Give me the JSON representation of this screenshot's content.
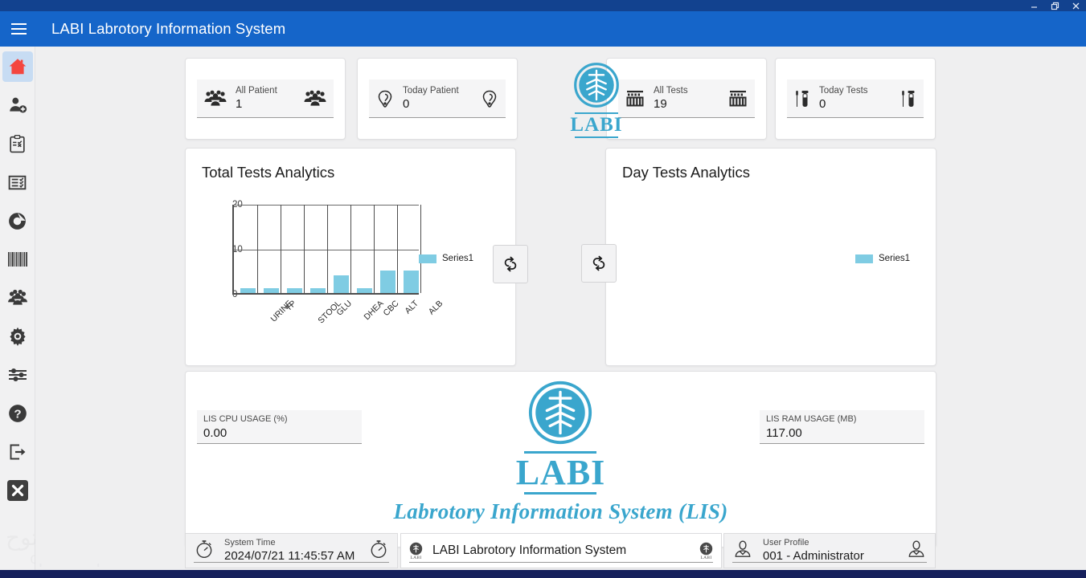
{
  "window": {
    "minimize_label": "minimize-icon",
    "restore_label": "restore-icon",
    "close_label": "close-icon"
  },
  "header": {
    "menu_icon": "hamburger-icon",
    "title": "LABI Labrotory Information System",
    "bg_color": "#1565c9"
  },
  "sidebar": {
    "items": [
      {
        "icon": "home-icon",
        "name": "home",
        "active": true
      },
      {
        "icon": "add-person-icon",
        "name": "add-patient",
        "active": false
      },
      {
        "icon": "clipboard-check-icon",
        "name": "requests",
        "active": false
      },
      {
        "icon": "list-check-icon",
        "name": "results",
        "active": false
      },
      {
        "icon": "circle-chart-icon",
        "name": "analytics",
        "active": false
      },
      {
        "icon": "barcode-icon",
        "name": "barcode",
        "active": false
      },
      {
        "icon": "users-group-icon",
        "name": "users",
        "active": false
      },
      {
        "icon": "gear-icon",
        "name": "settings",
        "active": false
      },
      {
        "icon": "sliders-icon",
        "name": "preferences",
        "active": false
      },
      {
        "icon": "help-icon",
        "name": "help",
        "active": false
      },
      {
        "icon": "logout-icon",
        "name": "logout",
        "active": false
      },
      {
        "icon": "close-box-icon",
        "name": "exit",
        "active": false
      }
    ]
  },
  "watermark": {
    "arabic": "السوق المفتوح",
    "latin": "opensooq",
    "suffix": ".com"
  },
  "stats": [
    {
      "label": "All Patient",
      "value": "1",
      "icon": "patients-group-icon"
    },
    {
      "label": "Today Patient",
      "value": "0",
      "icon": "patient-icon"
    },
    {
      "label": "All Tests",
      "value": "19",
      "icon": "test-rack-icon"
    },
    {
      "label": "Today Tests",
      "value": "0",
      "icon": "test-tube-icon"
    }
  ],
  "brand": {
    "mark": "labi-emblem-icon",
    "word": "LABI",
    "tagline": "Labrotory Information System (LIS)",
    "color": "#3aa6cd"
  },
  "panels": {
    "total": {
      "title": "Total Tests Analytics",
      "legend": "Series1",
      "refresh_icon": "refresh-icon"
    },
    "day": {
      "title": "Day Tests Analytics",
      "legend": "Series1",
      "refresh_icon": "refresh-icon"
    }
  },
  "chart_data": [
    {
      "type": "bar",
      "title": "Total Tests Analytics",
      "categories": [
        "URINE",
        "TP",
        "STOOL",
        "GLU",
        "DHEA",
        "CBC",
        "ALT",
        "ALB"
      ],
      "values": [
        1,
        1,
        1,
        1,
        4,
        1,
        5,
        5
      ],
      "series": [
        {
          "name": "Series1",
          "values": [
            1,
            1,
            1,
            1,
            4,
            1,
            5,
            5
          ]
        }
      ],
      "xlabel": "",
      "ylabel": "",
      "ylim": [
        0,
        20
      ],
      "yticks": [
        0,
        10,
        20
      ],
      "grid": true,
      "legend_position": "right",
      "bar_color": "#7fcce3"
    },
    {
      "type": "bar",
      "title": "Day Tests Analytics",
      "categories": [],
      "values": [],
      "series": [
        {
          "name": "Series1",
          "values": []
        }
      ],
      "xlabel": "",
      "ylabel": "",
      "ylim": [
        0,
        20
      ],
      "yticks": [],
      "grid": false,
      "legend_position": "right",
      "bar_color": "#7fcce3"
    }
  ],
  "usage": {
    "cpu_label": "LIS CPU USAGE (%)",
    "cpu_value": "0.00",
    "ram_label": "LIS RAM USAGE (MB)",
    "ram_value": "117.00"
  },
  "status": {
    "time_label": "System Time",
    "time_value": "2024/07/21 11:45:57 AM",
    "time_icon": "stopwatch-icon",
    "app_value": "LABI Labrotory Information System",
    "app_icon": "labi-mini-icon",
    "user_label": "User Profile",
    "user_value": "001 - Administrator",
    "user_icon": "user-icon"
  }
}
